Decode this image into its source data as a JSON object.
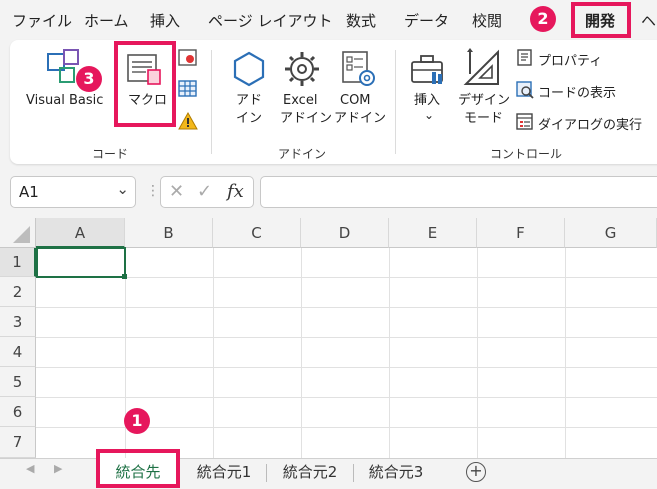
{
  "menu": {
    "tabs": [
      "ファイル",
      "ホーム",
      "挿入",
      "ページ レイアウト",
      "数式",
      "データ",
      "校閲",
      "開発",
      "ヘ"
    ]
  },
  "ribbon": {
    "code_group": {
      "label": "コード",
      "visual_basic": "Visual Basic",
      "macro": "マクロ"
    },
    "addin_group": {
      "label": "アドイン",
      "addin_line1": "アド",
      "addin_line2": "イン",
      "excel_line1": "Excel",
      "excel_line2": "アドイン",
      "com_line1": "COM",
      "com_line2": "アドイン"
    },
    "controls_group": {
      "label": "コントロール",
      "insert": "挿入",
      "insert_arrow": "⌄",
      "design_line1": "デザイン",
      "design_line2": "モード",
      "properties": "プロパティ",
      "view_code": "コードの表示",
      "run_dialog": "ダイアログの実行"
    }
  },
  "formula_bar": {
    "name_box": "A1",
    "fx": "fx",
    "cancel": "✕",
    "enter": "✓",
    "formula": ""
  },
  "grid": {
    "columns": [
      "A",
      "B",
      "C",
      "D",
      "E",
      "F",
      "G"
    ],
    "rows": [
      "1",
      "2",
      "3",
      "4",
      "5",
      "6",
      "7"
    ]
  },
  "sheets": {
    "tabs": [
      "統合先",
      "統合元1",
      "統合元2",
      "統合元3"
    ],
    "active": "統合先",
    "add": "+"
  },
  "callouts": [
    "1",
    "2",
    "3"
  ],
  "colors": {
    "highlight": "#e6175c",
    "active_sheet": "#1e7145",
    "accent_icon": "#2b6fb6"
  }
}
